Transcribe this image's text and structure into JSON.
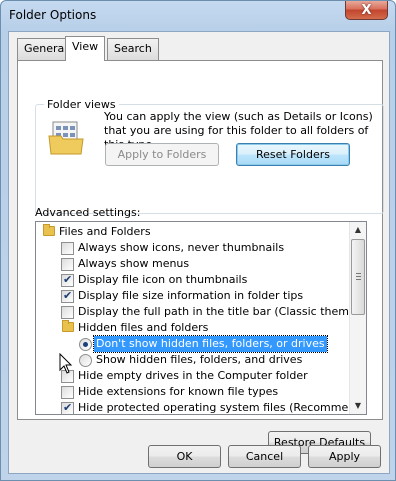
{
  "window": {
    "title": "Folder Options",
    "close_label": "X"
  },
  "tabs": [
    {
      "label": "General",
      "active": false
    },
    {
      "label": "View",
      "active": true
    },
    {
      "label": "Search",
      "active": false
    }
  ],
  "folder_views": {
    "title": "Folder views",
    "description": "You can apply the view (such as Details or Icons) that you are using for this folder to all folders of this type.",
    "apply_button": "Apply to Folders",
    "reset_button": "Reset Folders"
  },
  "advanced": {
    "label": "Advanced settings:",
    "items": [
      {
        "type": "folder",
        "label": "Files and Folders"
      },
      {
        "type": "checkbox",
        "label": "Always show icons, never thumbnails",
        "checked": false
      },
      {
        "type": "checkbox",
        "label": "Always show menus",
        "checked": false
      },
      {
        "type": "checkbox",
        "label": "Display file icon on thumbnails",
        "checked": true
      },
      {
        "type": "checkbox",
        "label": "Display file size information in folder tips",
        "checked": true
      },
      {
        "type": "checkbox",
        "label": "Display the full path in the title bar (Classic theme only)",
        "checked": false
      },
      {
        "type": "folder",
        "label": "Hidden files and folders"
      },
      {
        "type": "radio",
        "label": "Don't show hidden files, folders, or drives",
        "selected": true
      },
      {
        "type": "radio",
        "label": "Show hidden files, folders, and drives",
        "selected": false
      },
      {
        "type": "checkbox",
        "label": "Hide empty drives in the Computer folder",
        "checked": false
      },
      {
        "type": "checkbox",
        "label": "Hide extensions for known file types",
        "checked": false
      },
      {
        "type": "checkbox",
        "label": "Hide protected operating system files (Recommended)",
        "checked": true
      }
    ]
  },
  "buttons": {
    "restore_defaults": "Restore Defaults",
    "ok": "OK",
    "cancel": "Cancel",
    "apply": "Apply"
  }
}
